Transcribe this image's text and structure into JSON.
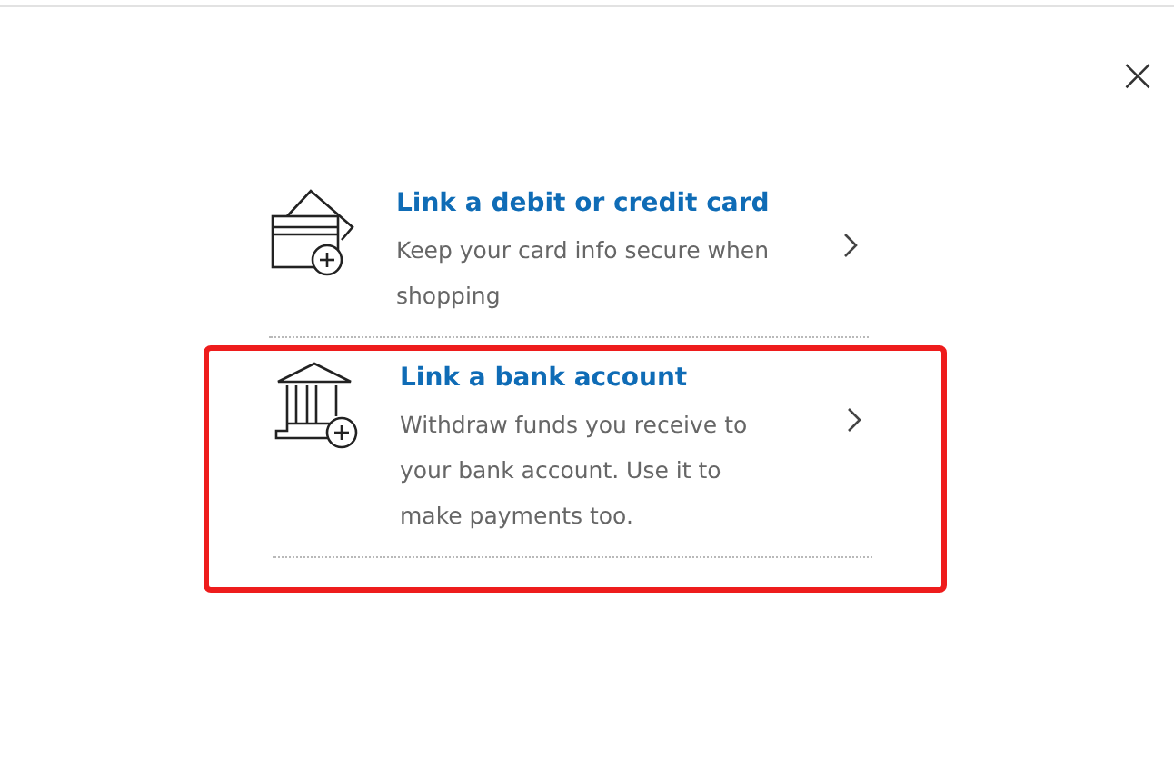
{
  "close_button": {
    "label": "×"
  },
  "options": [
    {
      "kind": "card",
      "title": "Link a debit or credit card",
      "description": "Keep your card info secure when shopping",
      "highlighted": false
    },
    {
      "kind": "bank",
      "title": "Link a bank account",
      "description": "Withdraw funds you receive to your bank account. Use it to make payments too.",
      "highlighted": true
    }
  ]
}
